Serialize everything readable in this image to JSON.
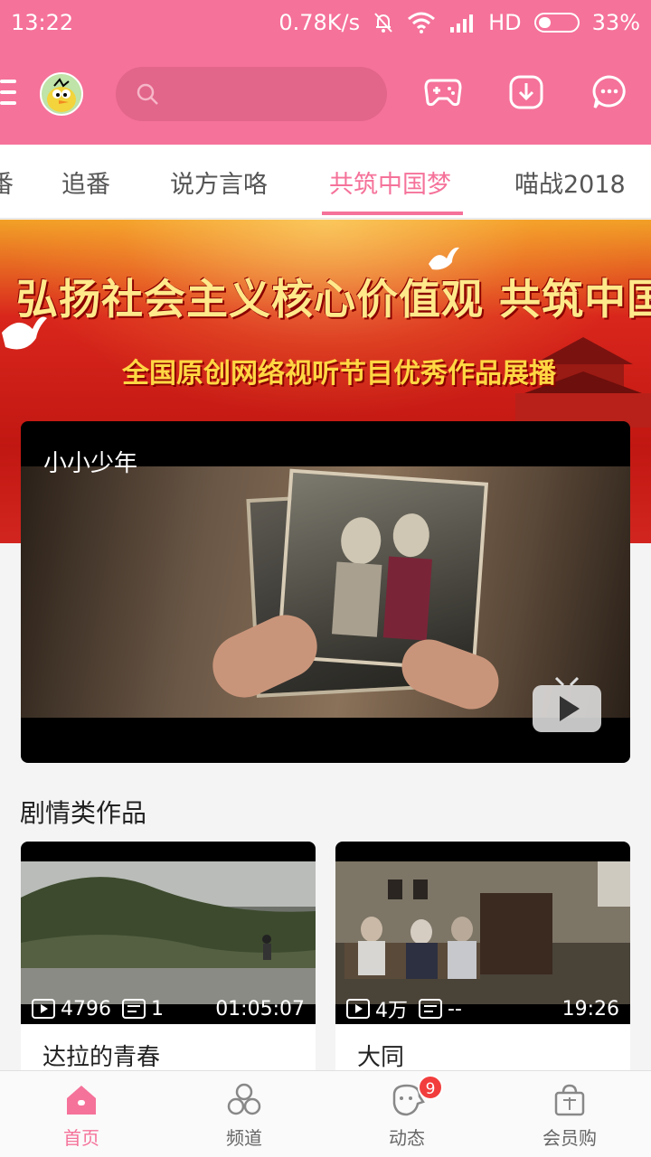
{
  "status_bar": {
    "time": "13:22",
    "network_speed": "0.78K/s",
    "network_type": "HD",
    "battery_percent": "33%",
    "battery_level": 0.33
  },
  "header": {
    "search_placeholder": "",
    "icons": [
      "menu-icon",
      "avatar",
      "search-icon",
      "game-controller-icon",
      "download-icon",
      "message-icon"
    ]
  },
  "tabs": {
    "items": [
      {
        "label": "番"
      },
      {
        "label": "追番"
      },
      {
        "label": "说方言咯"
      },
      {
        "label": "共筑中国梦"
      },
      {
        "label": "喵战2018"
      }
    ],
    "active_index": 3
  },
  "banner": {
    "headline": "弘扬社会主义核心价值观  共筑中国梦",
    "subline": "全国原创网络视听节目优秀作品展播"
  },
  "featured": {
    "title": "小小少年"
  },
  "section": {
    "title": "剧情类作品"
  },
  "cards": [
    {
      "title": "达拉的青春",
      "plays": "4796",
      "danmaku": "1",
      "duration": "01:05:07"
    },
    {
      "title": "大同",
      "plays": "4万",
      "danmaku": "--",
      "duration": "19:26"
    }
  ],
  "bottom_nav": {
    "items": [
      {
        "label": "首页",
        "icon": "home-icon",
        "active": true
      },
      {
        "label": "频道",
        "icon": "channel-icon",
        "active": false
      },
      {
        "label": "动态",
        "icon": "activity-icon",
        "active": false,
        "badge": "9"
      },
      {
        "label": "会员购",
        "icon": "shopping-bag-icon",
        "active": false
      }
    ]
  },
  "colors": {
    "brand_pink": "#f5729a",
    "badge_red": "#f23d3d"
  }
}
